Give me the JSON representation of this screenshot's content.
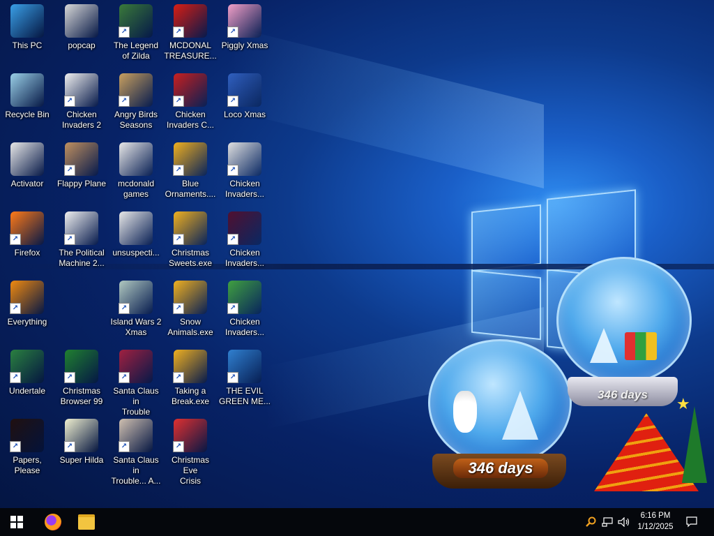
{
  "desktop": {
    "icons": [
      {
        "label": "This PC",
        "color": "#3aa0e8"
      },
      {
        "label": "popcap",
        "color": "#d8d8d8"
      },
      {
        "label": "The Legend\nof Zilda",
        "color": "#3a7a3a"
      },
      {
        "label": "MCDONAL\nTREASURE...",
        "color": "#d81e14"
      },
      {
        "label": "Piggly Xmas",
        "color": "#f2a0c8"
      },
      {
        "label": "Recycle Bin",
        "color": "#9ad0e8"
      },
      {
        "label": "Chicken\nInvaders 2",
        "color": "#f0f0f0"
      },
      {
        "label": "Angry Birds\nSeasons",
        "color": "#c8a060"
      },
      {
        "label": "Chicken\nInvaders C...",
        "color": "#c82020"
      },
      {
        "label": "Loco Xmas",
        "color": "#3060c0"
      },
      {
        "label": "Activator",
        "color": "#e8e8e8"
      },
      {
        "label": "Flappy Plane",
        "color": "#c09060"
      },
      {
        "label": "mcdonald\ngames",
        "color": "#e8e8e8"
      },
      {
        "label": "Blue\nOrnaments....",
        "color": "#f0b020"
      },
      {
        "label": "Chicken\nInvaders...",
        "color": "#e0e0e0"
      },
      {
        "label": "Firefox",
        "color": "#ff7a18"
      },
      {
        "label": "The Political\nMachine 2...",
        "color": "#f0f0f0"
      },
      {
        "label": "unsuspecti...",
        "color": "#e8e8e8"
      },
      {
        "label": "Christmas\nSweets.exe",
        "color": "#f0b020"
      },
      {
        "label": "Chicken\nInvaders...",
        "color": "#501030"
      },
      {
        "label": "Everything",
        "color": "#f08a10"
      },
      {
        "label": "Island Wars 2\nXmas",
        "color": "#b0c8c0"
      },
      {
        "label": "Snow\nAnimals.exe",
        "color": "#f0b020"
      },
      {
        "label": "Chicken\nInvaders...",
        "color": "#40a040"
      },
      {
        "label": "Undertale",
        "color": "#2a8040"
      },
      {
        "label": "Christmas\nBrowser 99",
        "color": "#208030"
      },
      {
        "label": "Santa Claus in\nTrouble",
        "color": "#a02040"
      },
      {
        "label": "Taking a\nBreak.exe",
        "color": "#f0b020"
      },
      {
        "label": "THE EVIL\nGREEN ME...",
        "color": "#3080d0"
      },
      {
        "label": "Papers, Please",
        "color": "#201010"
      },
      {
        "label": "Super Hilda",
        "color": "#f0f0d0"
      },
      {
        "label": "Santa Claus in\nTrouble... A...",
        "color": "#d0c0b0"
      },
      {
        "label": "Christmas Eve\nCrisis",
        "color": "#e03030"
      }
    ]
  },
  "widgets": {
    "globe_small_days": "346 days",
    "globe_large_days": "346 days"
  },
  "taskbar": {
    "time": "6:16 PM",
    "date": "1/12/2025"
  }
}
